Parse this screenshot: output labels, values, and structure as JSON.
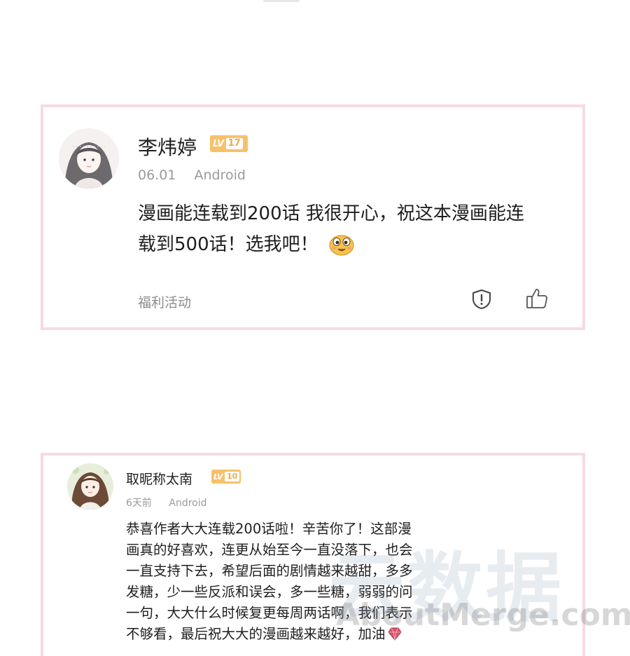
{
  "comments": [
    {
      "username": "李炜婷",
      "level_tag": "LV",
      "level": "17",
      "date": "06.01",
      "device": "Android",
      "content_line1": "漫画能连载到200话 我很开心，祝这本漫画能连",
      "content_line2": "载到500话！选我吧！",
      "tag": "福利活动",
      "emoji_icon": "happy-face-emoji"
    },
    {
      "username": "取昵称太南",
      "level_tag": "LV",
      "level": "10",
      "date": "6天前",
      "device": "Android",
      "content_lines": [
        "恭喜作者大大连载200话啦！辛苦你了！这部漫",
        "画真的好喜欢，连更从始至今一直没落下，也会",
        "一直支持下去，希望后面的剧情越来越甜，多多",
        "发糖，少一些反派和误会，多一些糖，弱弱的问",
        "一句，大大什么时候复更每周两话啊，我们表示",
        "不够看，最后祝大大的漫画越来越好，加油"
      ],
      "trailing_icon": "diamond-heart-emoji"
    }
  ],
  "watermark": {
    "cn_text": "云数据",
    "en_text": "AboutMerge.com"
  },
  "colors": {
    "card_border": "#f6dbe1",
    "level_badge": "#f6c16a",
    "meta_text": "#9a9a9a"
  }
}
